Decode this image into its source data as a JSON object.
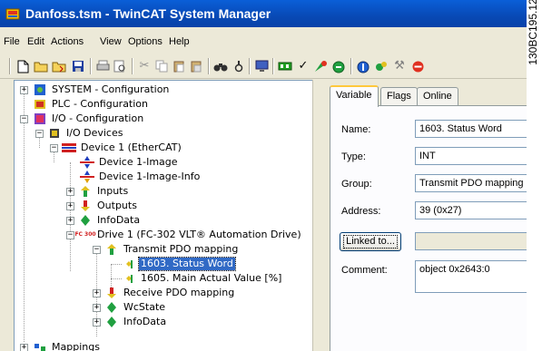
{
  "window": {
    "title": "Danfoss.tsm - TwinCAT System Manager"
  },
  "menu": [
    {
      "label": "File"
    },
    {
      "label": "Edit"
    },
    {
      "label": "Actions"
    },
    {
      "label": "View"
    },
    {
      "label": "Options"
    },
    {
      "label": "Help"
    }
  ],
  "tree": {
    "system": "SYSTEM - Configuration",
    "plc": "PLC - Configuration",
    "io": "I/O - Configuration",
    "io_devices": "I/O Devices",
    "device1": "Device 1 (EtherCAT)",
    "device1_image": "Device 1-Image",
    "device1_image_info": "Device 1-Image-Info",
    "inputs": "Inputs",
    "outputs": "Outputs",
    "infodata": "InfoData",
    "drive1": "Drive 1 (FC-302 VLT® Automation Drive)",
    "drive1_icon_text": "FC 300",
    "transmit_pdo": "Transmit PDO mapping",
    "status_word": "1603. Status Word",
    "main_actual": "1605. Main Actual Value [%]",
    "receive_pdo": "Receive PDO mapping",
    "wcstate": "WcState",
    "infodata2": "InfoData",
    "mappings": "Mappings"
  },
  "tabs": {
    "variable": "Variable",
    "flags": "Flags",
    "online": "Online"
  },
  "form": {
    "name_label": "Name:",
    "name_value": "1603. Status Word",
    "type_label": "Type:",
    "type_value": "INT",
    "group_label": "Group:",
    "group_value": "Transmit PDO mapping",
    "address_label": "Address:",
    "address_value": "39 (0x27)",
    "linked_button": "Linked to...",
    "linked_value": "",
    "comment_label": "Comment:",
    "comment_value": "object 0x2643:0"
  },
  "figure_code": "130BC195.12",
  "colors": {
    "titlebar": "#0a5fd8",
    "selection": "#316ac5",
    "tab_highlight": "#ffc83c"
  }
}
